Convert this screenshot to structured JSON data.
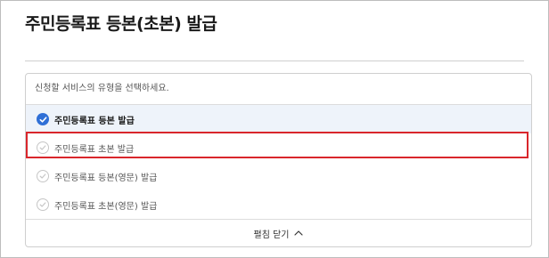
{
  "page": {
    "title": "주민등록표 등본(초본) 발급"
  },
  "selector": {
    "header": "신청할 서비스의 유형을 선택하세요.",
    "options": [
      {
        "label": "주민등록표 등본 발급",
        "selected": true
      },
      {
        "label": "주민등록표 초본 발급",
        "selected": false,
        "highlighted": true
      },
      {
        "label": "주민등록표 등본(영문) 발급",
        "selected": false
      },
      {
        "label": "주민등록표 초본(영문) 발급",
        "selected": false
      }
    ],
    "collapse_label": "펼침 닫기"
  },
  "colors": {
    "accent": "#2f6fd6",
    "highlight_border": "#d9262c"
  }
}
